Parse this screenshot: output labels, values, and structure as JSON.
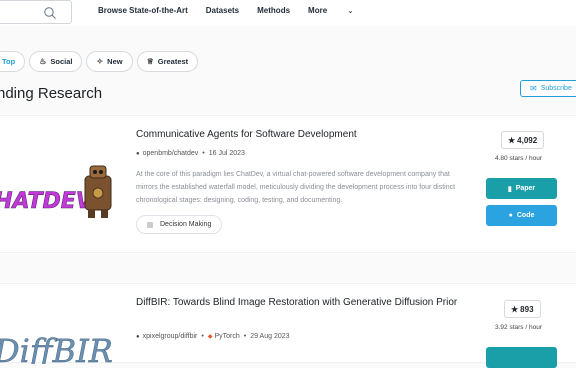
{
  "nav": {
    "items": [
      "Browse State-of-the-Art",
      "Datasets",
      "Methods",
      "More"
    ]
  },
  "filters": [
    {
      "label": "Top",
      "icon": "top-icon"
    },
    {
      "label": "Social",
      "icon": "fire-icon"
    },
    {
      "label": "New",
      "icon": "sparkle-icon"
    },
    {
      "label": "Greatest",
      "icon": "trophy-icon"
    }
  ],
  "section": {
    "title": "nding Research",
    "subscribe_label": "Subscribe"
  },
  "papers": [
    {
      "title": "Communicative Agents for Software Development",
      "repo": "openbmb/chatdev",
      "date": "16 Jul 2023",
      "abstract": "At the core of this paradigm lies ChatDev, a virtual chat-powered software development company that mirrors the established waterfall model, meticulously dividing the development process into four distinct chronological stages: designing, coding, testing, and documenting.",
      "tag": "Decision Making",
      "stars": "4,092",
      "rate": "4.80 stars / hour",
      "paper_label": "Paper",
      "code_label": "Code",
      "logo_text": "CHATDEV"
    },
    {
      "title": "DiffBIR: Towards Blind Image Restoration with Generative Diffusion Prior",
      "repo": "xpixelgroup/diffbir",
      "framework": "PyTorch",
      "date": "29 Aug 2023",
      "stars": "893",
      "rate": "3.92 stars / hour",
      "logo_text": "DiffBIR"
    }
  ],
  "colors": {
    "accent": "#21a0d8",
    "paper_button": "#1a9fa8",
    "code_button": "#2aa3e0"
  }
}
